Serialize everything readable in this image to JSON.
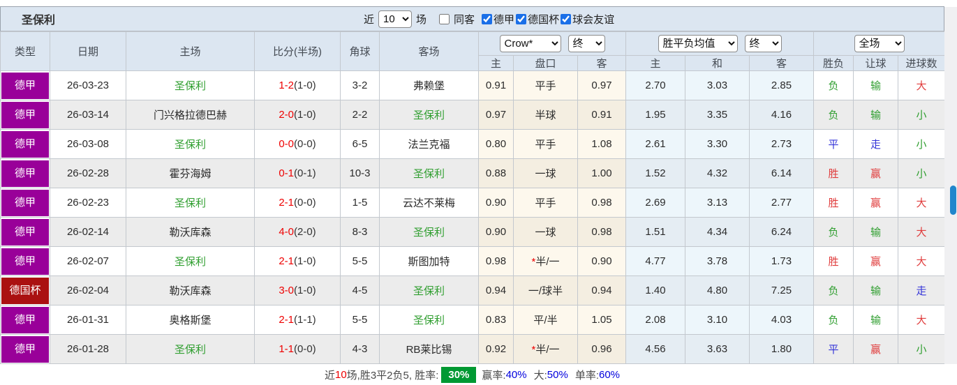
{
  "header": {
    "title": "圣保利",
    "near_label": "近",
    "matches_count": "10",
    "matches_suffix": "场",
    "filters": [
      {
        "label": "同客",
        "checked": false
      },
      {
        "label": "德甲",
        "checked": true
      },
      {
        "label": "德国杯",
        "checked": true
      },
      {
        "label": "球会友谊",
        "checked": true
      }
    ]
  },
  "controls": {
    "company": "Crow*",
    "company_time": "终",
    "odds_type": "胜平负均值",
    "odds_time": "终",
    "scope": "全场"
  },
  "columns": {
    "type": "类型",
    "date": "日期",
    "home": "主场",
    "score": "比分(半场)",
    "corner": "角球",
    "away": "客场",
    "ah_home": "主",
    "ah_line": "盘口",
    "ah_away": "客",
    "odds_home": "主",
    "odds_draw": "和",
    "odds_away": "客",
    "result": "胜负",
    "handicap_result": "让球",
    "goals": "进球数"
  },
  "rows": [
    {
      "league": "德甲",
      "league_color": "purple",
      "date": "26-03-23",
      "home": {
        "text": "圣保利",
        "focus": true
      },
      "score": {
        "full": "1-2",
        "half": "(1-0)"
      },
      "corner": "3-2",
      "away": {
        "text": "弗赖堡",
        "focus": false
      },
      "ah": {
        "home": "0.91",
        "line": "平手",
        "star": false,
        "away": "0.97"
      },
      "odds": {
        "home": "2.70",
        "draw": "3.03",
        "away": "2.85"
      },
      "result": {
        "text": "负",
        "c": "green"
      },
      "ahres": {
        "text": "输",
        "c": "green"
      },
      "goals": {
        "text": "大",
        "c": "red"
      }
    },
    {
      "league": "德甲",
      "league_color": "purple",
      "date": "26-03-14",
      "home": {
        "text": "门兴格拉德巴赫",
        "focus": false
      },
      "score": {
        "full": "2-0",
        "half": "(1-0)"
      },
      "corner": "2-2",
      "away": {
        "text": "圣保利",
        "focus": true
      },
      "ah": {
        "home": "0.97",
        "line": "半球",
        "star": false,
        "away": "0.91"
      },
      "odds": {
        "home": "1.95",
        "draw": "3.35",
        "away": "4.16"
      },
      "result": {
        "text": "负",
        "c": "green"
      },
      "ahres": {
        "text": "输",
        "c": "green"
      },
      "goals": {
        "text": "小",
        "c": "green"
      }
    },
    {
      "league": "德甲",
      "league_color": "purple",
      "date": "26-03-08",
      "home": {
        "text": "圣保利",
        "focus": true
      },
      "score": {
        "full": "0-0",
        "half": "(0-0)"
      },
      "corner": "6-5",
      "away": {
        "text": "法兰克福",
        "focus": false
      },
      "ah": {
        "home": "0.80",
        "line": "平手",
        "star": false,
        "away": "1.08"
      },
      "odds": {
        "home": "2.61",
        "draw": "3.30",
        "away": "2.73"
      },
      "result": {
        "text": "平",
        "c": "blue"
      },
      "ahres": {
        "text": "走",
        "c": "blue"
      },
      "goals": {
        "text": "小",
        "c": "green"
      }
    },
    {
      "league": "德甲",
      "league_color": "purple",
      "date": "26-02-28",
      "home": {
        "text": "霍芬海姆",
        "focus": false
      },
      "score": {
        "full": "0-1",
        "half": "(0-1)"
      },
      "corner": "10-3",
      "away": {
        "text": "圣保利",
        "focus": true
      },
      "ah": {
        "home": "0.88",
        "line": "一球",
        "star": false,
        "away": "1.00"
      },
      "odds": {
        "home": "1.52",
        "draw": "4.32",
        "away": "6.14"
      },
      "result": {
        "text": "胜",
        "c": "red"
      },
      "ahres": {
        "text": "赢",
        "c": "red"
      },
      "goals": {
        "text": "小",
        "c": "green"
      }
    },
    {
      "league": "德甲",
      "league_color": "purple",
      "date": "26-02-23",
      "home": {
        "text": "圣保利",
        "focus": true
      },
      "score": {
        "full": "2-1",
        "half": "(0-0)"
      },
      "corner": "1-5",
      "away": {
        "text": "云达不莱梅",
        "focus": false
      },
      "ah": {
        "home": "0.90",
        "line": "平手",
        "star": false,
        "away": "0.98"
      },
      "odds": {
        "home": "2.69",
        "draw": "3.13",
        "away": "2.77"
      },
      "result": {
        "text": "胜",
        "c": "red"
      },
      "ahres": {
        "text": "赢",
        "c": "red"
      },
      "goals": {
        "text": "大",
        "c": "red"
      }
    },
    {
      "league": "德甲",
      "league_color": "purple",
      "date": "26-02-14",
      "home": {
        "text": "勒沃库森",
        "focus": false
      },
      "score": {
        "full": "4-0",
        "half": "(2-0)"
      },
      "corner": "8-3",
      "away": {
        "text": "圣保利",
        "focus": true
      },
      "ah": {
        "home": "0.90",
        "line": "一球",
        "star": false,
        "away": "0.98"
      },
      "odds": {
        "home": "1.51",
        "draw": "4.34",
        "away": "6.24"
      },
      "result": {
        "text": "负",
        "c": "green"
      },
      "ahres": {
        "text": "输",
        "c": "green"
      },
      "goals": {
        "text": "大",
        "c": "red"
      }
    },
    {
      "league": "德甲",
      "league_color": "purple",
      "date": "26-02-07",
      "home": {
        "text": "圣保利",
        "focus": true
      },
      "score": {
        "full": "2-1",
        "half": "(1-0)"
      },
      "corner": "5-5",
      "away": {
        "text": "斯图加特",
        "focus": false
      },
      "ah": {
        "home": "0.98",
        "line": "半/一",
        "star": true,
        "away": "0.90"
      },
      "odds": {
        "home": "4.77",
        "draw": "3.78",
        "away": "1.73"
      },
      "result": {
        "text": "胜",
        "c": "red"
      },
      "ahres": {
        "text": "赢",
        "c": "red"
      },
      "goals": {
        "text": "大",
        "c": "red"
      }
    },
    {
      "league": "德国杯",
      "league_color": "dark_red",
      "date": "26-02-04",
      "home": {
        "text": "勒沃库森",
        "focus": false
      },
      "score": {
        "full": "3-0",
        "half": "(1-0)"
      },
      "corner": "4-5",
      "away": {
        "text": "圣保利",
        "focus": true
      },
      "ah": {
        "home": "0.94",
        "line": "一/球半",
        "star": false,
        "away": "0.94"
      },
      "odds": {
        "home": "1.40",
        "draw": "4.80",
        "away": "7.25"
      },
      "result": {
        "text": "负",
        "c": "green"
      },
      "ahres": {
        "text": "输",
        "c": "green"
      },
      "goals": {
        "text": "走",
        "c": "blue"
      }
    },
    {
      "league": "德甲",
      "league_color": "purple",
      "date": "26-01-31",
      "home": {
        "text": "奥格斯堡",
        "focus": false
      },
      "score": {
        "full": "2-1",
        "half": "(1-1)"
      },
      "corner": "5-5",
      "away": {
        "text": "圣保利",
        "focus": true
      },
      "ah": {
        "home": "0.83",
        "line": "平/半",
        "star": false,
        "away": "1.05"
      },
      "odds": {
        "home": "2.08",
        "draw": "3.10",
        "away": "4.03"
      },
      "result": {
        "text": "负",
        "c": "green"
      },
      "ahres": {
        "text": "输",
        "c": "green"
      },
      "goals": {
        "text": "大",
        "c": "red"
      }
    },
    {
      "league": "德甲",
      "league_color": "purple",
      "date": "26-01-28",
      "home": {
        "text": "圣保利",
        "focus": true
      },
      "score": {
        "full": "1-1",
        "half": "(0-0)"
      },
      "corner": "4-3",
      "away": {
        "text": "RB莱比锡",
        "focus": false
      },
      "ah": {
        "home": "0.92",
        "line": "半/一",
        "star": true,
        "away": "0.96"
      },
      "odds": {
        "home": "4.56",
        "draw": "3.63",
        "away": "1.80"
      },
      "result": {
        "text": "平",
        "c": "blue"
      },
      "ahres": {
        "text": "赢",
        "c": "red"
      },
      "goals": {
        "text": "小",
        "c": "green"
      }
    }
  ],
  "footer": {
    "near": "近",
    "count": "10",
    "summary": "场,胜3平2负5, 胜率:",
    "win_rate": "30%",
    "win_label": "赢率:",
    "win_value": "40%",
    "big_label": "大:",
    "big_value": "50%",
    "single_label": "单率:",
    "single_value": "60%"
  },
  "colors": {
    "red": "#e03c3c",
    "green": "#2f9e2f",
    "blue": "#3434d8",
    "score_red": "#ee0000",
    "team_green": "#2f9e2f",
    "league_purple": "#990099",
    "league_dark_red": "#aa1111",
    "badge_green": "#009933",
    "percent_blue": "#0000dd",
    "count_red": "#ee0000",
    "scrollbar_blue": "#2086cc",
    "header_bg": "#dce6f1"
  }
}
